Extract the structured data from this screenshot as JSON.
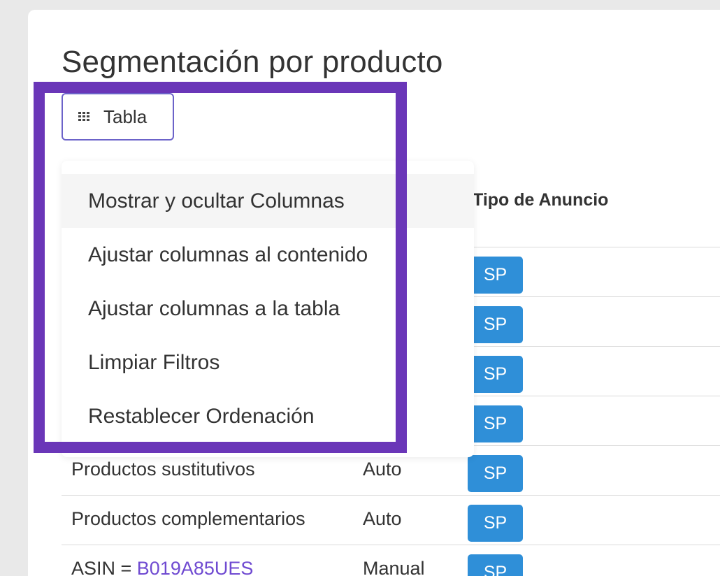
{
  "page": {
    "title": "Segmentación por producto"
  },
  "toolbar": {
    "table_button_label": "Tabla"
  },
  "table": {
    "visible_header": "Tipo de Anuncio",
    "rows": [
      {
        "name": "",
        "type": "",
        "badge": "SP"
      },
      {
        "name": "",
        "type": "",
        "badge": "SP"
      },
      {
        "name": "",
        "type": "",
        "badge": "SP"
      },
      {
        "name": "",
        "type": "",
        "badge": "SP"
      },
      {
        "name": "Productos sustitutivos",
        "type": "Auto",
        "badge": "SP"
      },
      {
        "name": "Productos complementarios",
        "type": "Auto",
        "badge": "SP"
      },
      {
        "name_prefix": "ASIN = ",
        "name_asin": "B019A85UES",
        "type": "Manual",
        "badge": "SP"
      }
    ]
  },
  "dropdown": {
    "items": [
      "Mostrar y ocultar Columnas",
      "Ajustar columnas al contenido",
      "Ajustar columnas a la tabla",
      "Limpiar Filtros",
      "Restablecer Ordenación"
    ]
  },
  "colors": {
    "highlight": "#6a36b8",
    "badge": "#2f8fd8",
    "button_border": "#6c63c9",
    "asin_link": "#6f4ad1"
  }
}
